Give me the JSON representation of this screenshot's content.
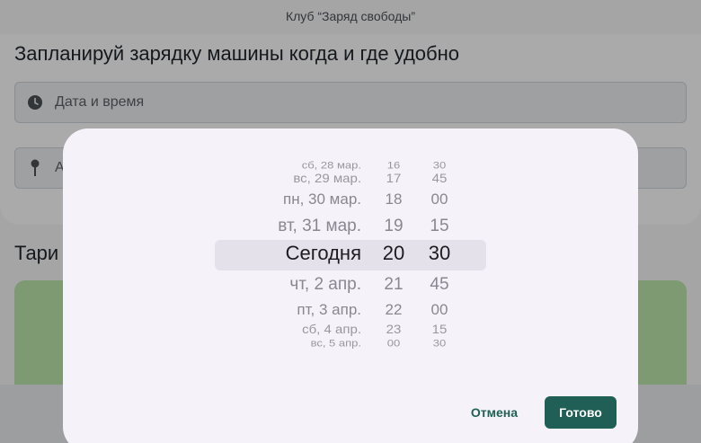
{
  "app": {
    "title": "Клуб “Заряд свободы”"
  },
  "main": {
    "heading": "Запланируй зарядку машины когда и где удобно",
    "datetime_placeholder": "Дата и время",
    "address_placeholder": "А",
    "tariffs_heading": "Тари"
  },
  "picker": {
    "rows": [
      {
        "date": "сб, 28 мар.",
        "hour": "16",
        "minute": "30"
      },
      {
        "date": "вс, 29 мар.",
        "hour": "17",
        "minute": "45"
      },
      {
        "date": "пн, 30 мар.",
        "hour": "18",
        "minute": "00"
      },
      {
        "date": "вт, 31 мар.",
        "hour": "19",
        "minute": "15"
      },
      {
        "date": "Сегодня",
        "hour": "20",
        "minute": "30"
      },
      {
        "date": "чт, 2 апр.",
        "hour": "21",
        "minute": "45"
      },
      {
        "date": "пт, 3 апр.",
        "hour": "22",
        "minute": "00"
      },
      {
        "date": "сб, 4 апр.",
        "hour": "23",
        "minute": "15"
      },
      {
        "date": "вс, 5 апр.",
        "hour": "00",
        "minute": "30"
      }
    ],
    "selected_index": 4
  },
  "dialog": {
    "cancel_label": "Отмена",
    "ok_label": "Готово"
  },
  "colors": {
    "accent": "#1f5f55",
    "tariff_card": "#b9e3a9"
  }
}
